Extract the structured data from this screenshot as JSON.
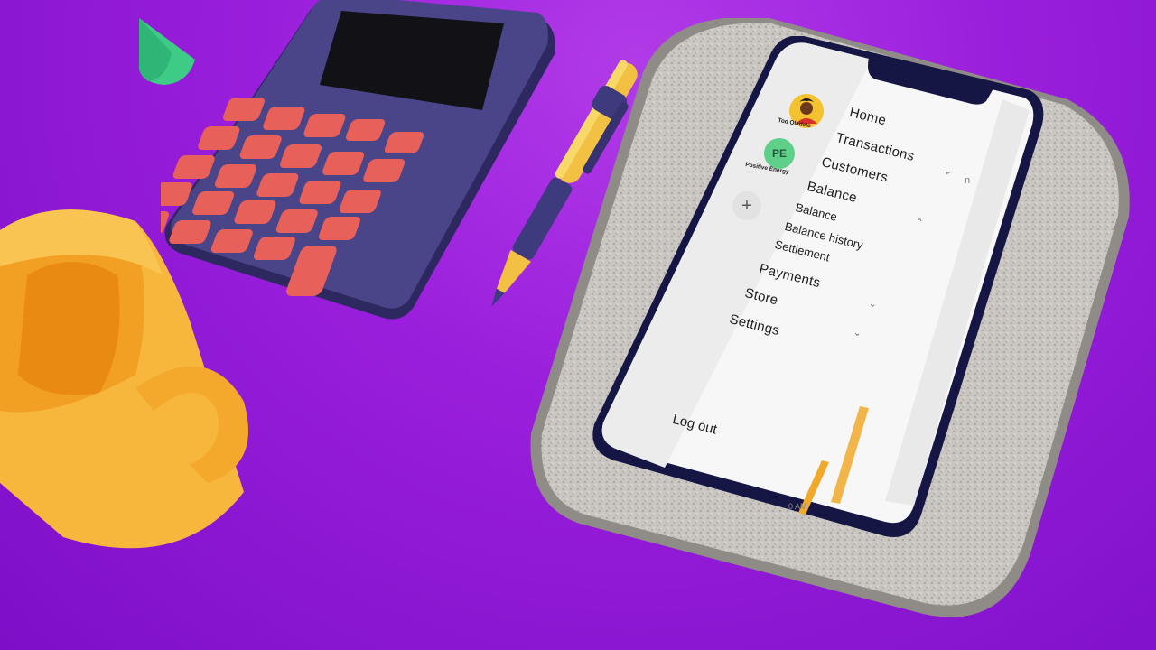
{
  "profiles": {
    "user_name": "Tod Oladele",
    "business_initials": "PE",
    "business_name": "Positive Energy",
    "add_icon": "plus-icon"
  },
  "menu": {
    "home": "Home",
    "transactions": "Transactions",
    "customers": "Customers",
    "balance": "Balance",
    "balance_sub": "Balance",
    "balance_history": "Balance history",
    "settlement": "Settlement",
    "payments": "Payments",
    "store": "Store",
    "settings": "Settings",
    "logout": "Log out"
  },
  "background_fragments": {
    "time_fragment": "0 AM",
    "field_fragment": "n"
  },
  "colors": {
    "background": "#9a1fdc",
    "accent_active": "#f0a92b",
    "logout": "#e0453c",
    "avatar_green": "#5fd08a",
    "calculator_body": "#3f3a78",
    "calculator_keys": "#e8605a",
    "mug": "#f6b73c",
    "pen": "#f2c043"
  }
}
